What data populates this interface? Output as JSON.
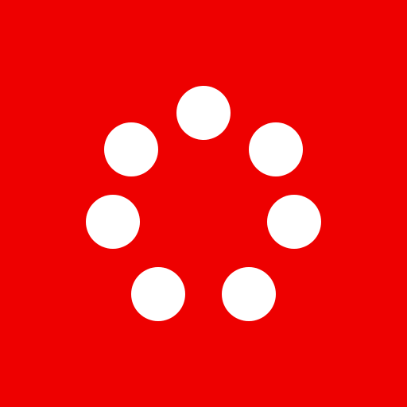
{
  "icon": {
    "name": "loading-spinner-icon",
    "background_color": "#ee0000",
    "dot_color": "#ffffff",
    "dot_count": 7
  }
}
